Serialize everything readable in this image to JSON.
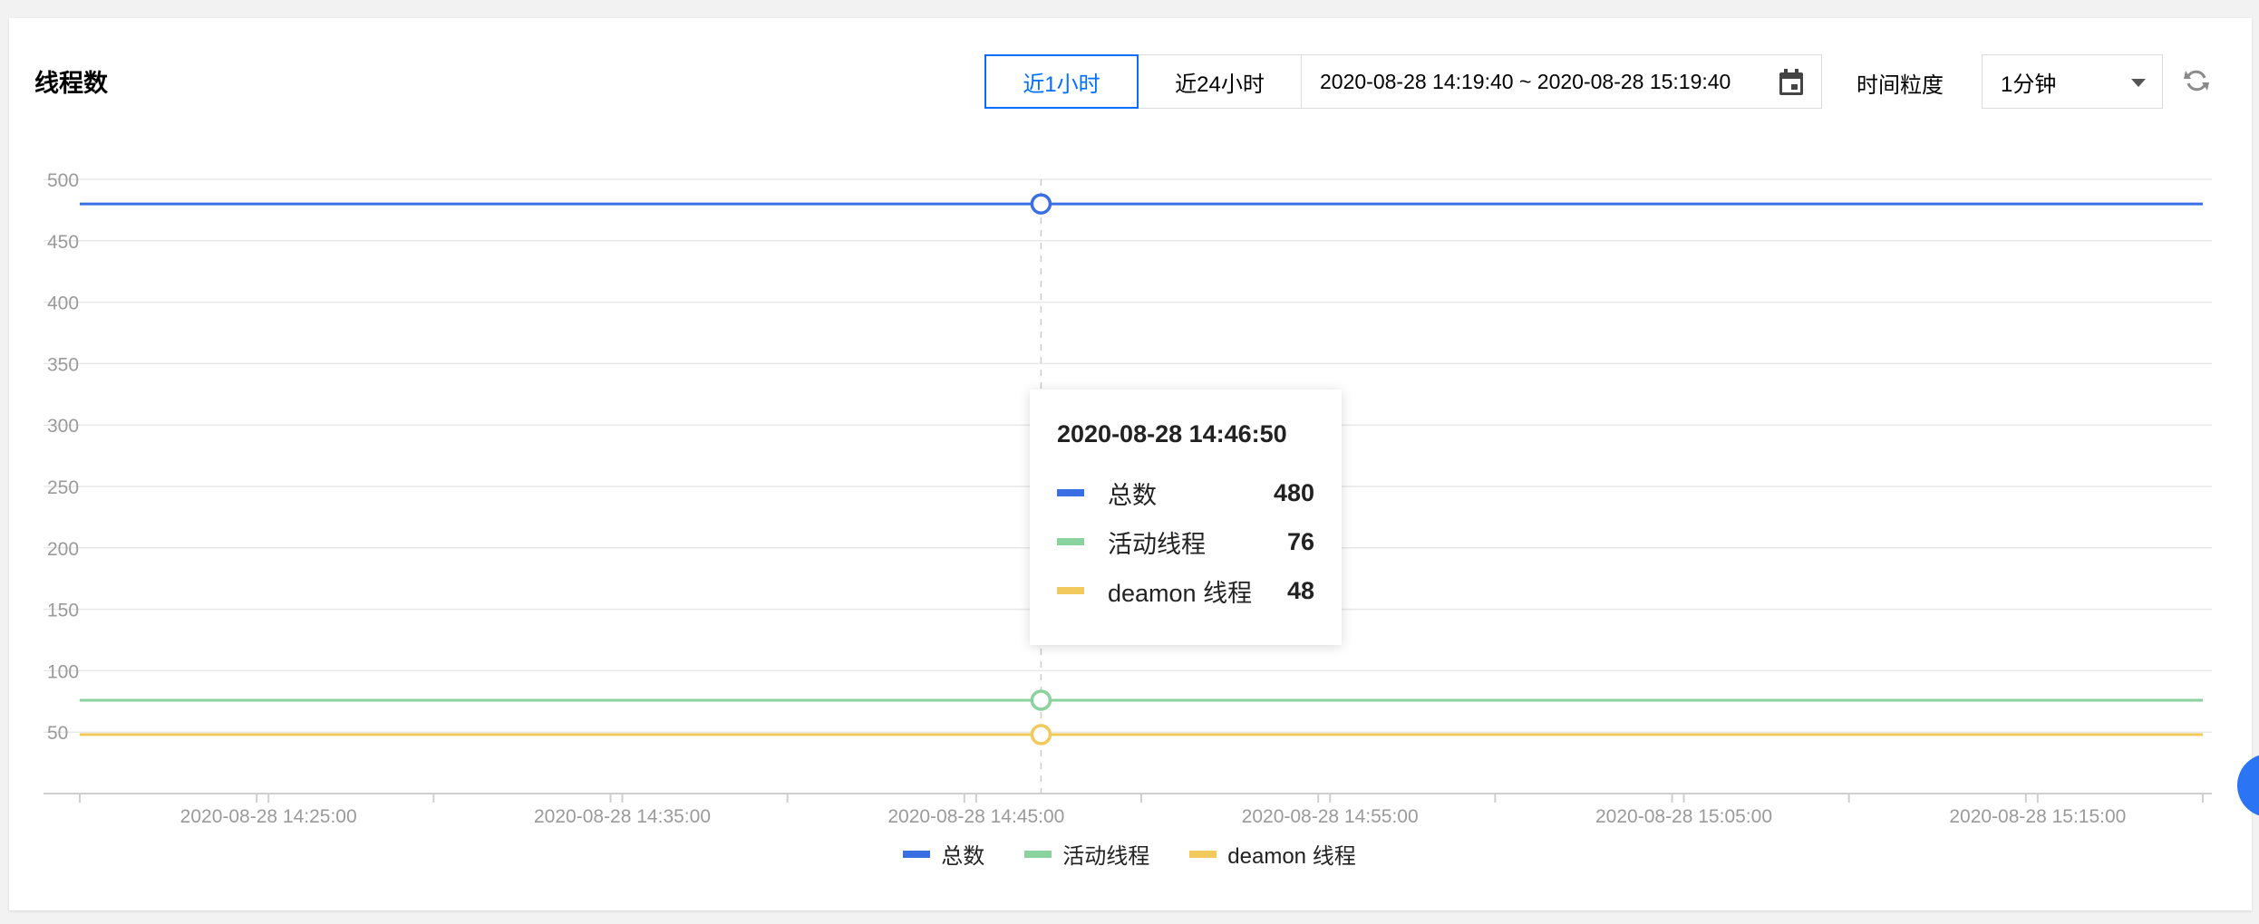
{
  "panel": {
    "title": "线程数",
    "range_buttons": {
      "last_1h": "近1小时",
      "last_24h": "近24小时"
    },
    "date_range": "2020-08-28 14:19:40 ~ 2020-08-28 15:19:40",
    "granularity_label": "时间粒度",
    "granularity_value": "1分钟",
    "active_color": "#006eff"
  },
  "tooltip": {
    "time": "2020-08-28 14:46:50",
    "rows": [
      {
        "name": "总数",
        "value": "480",
        "color": "#3a6fe3"
      },
      {
        "name": "活动线程",
        "value": "76",
        "color": "#8ad29e"
      },
      {
        "name": "deamon 线程",
        "value": "48",
        "color": "#f2c95c"
      }
    ]
  },
  "chart_data": {
    "type": "line",
    "ylim": [
      0,
      500
    ],
    "yticks": [
      50,
      100,
      150,
      200,
      250,
      300,
      350,
      400,
      450,
      500
    ],
    "x_range": [
      "2020-08-28 14:19:40",
      "2020-08-28 15:19:40"
    ],
    "x_tick_labels": [
      "2020-08-28 14:25:00",
      "2020-08-28 14:35:00",
      "2020-08-28 14:45:00",
      "2020-08-28 14:55:00",
      "2020-08-28 15:05:00",
      "2020-08-28 15:15:00"
    ],
    "highlight_time": "2020-08-28 14:46:50",
    "series": [
      {
        "name": "总数",
        "color": "#3a6fe3",
        "value": 480
      },
      {
        "name": "活动线程",
        "color": "#8ad29e",
        "value": 76
      },
      {
        "name": "deamon 线程",
        "color": "#f2c95c",
        "value": 48
      }
    ],
    "grid": true,
    "legend": "bottom-center"
  }
}
